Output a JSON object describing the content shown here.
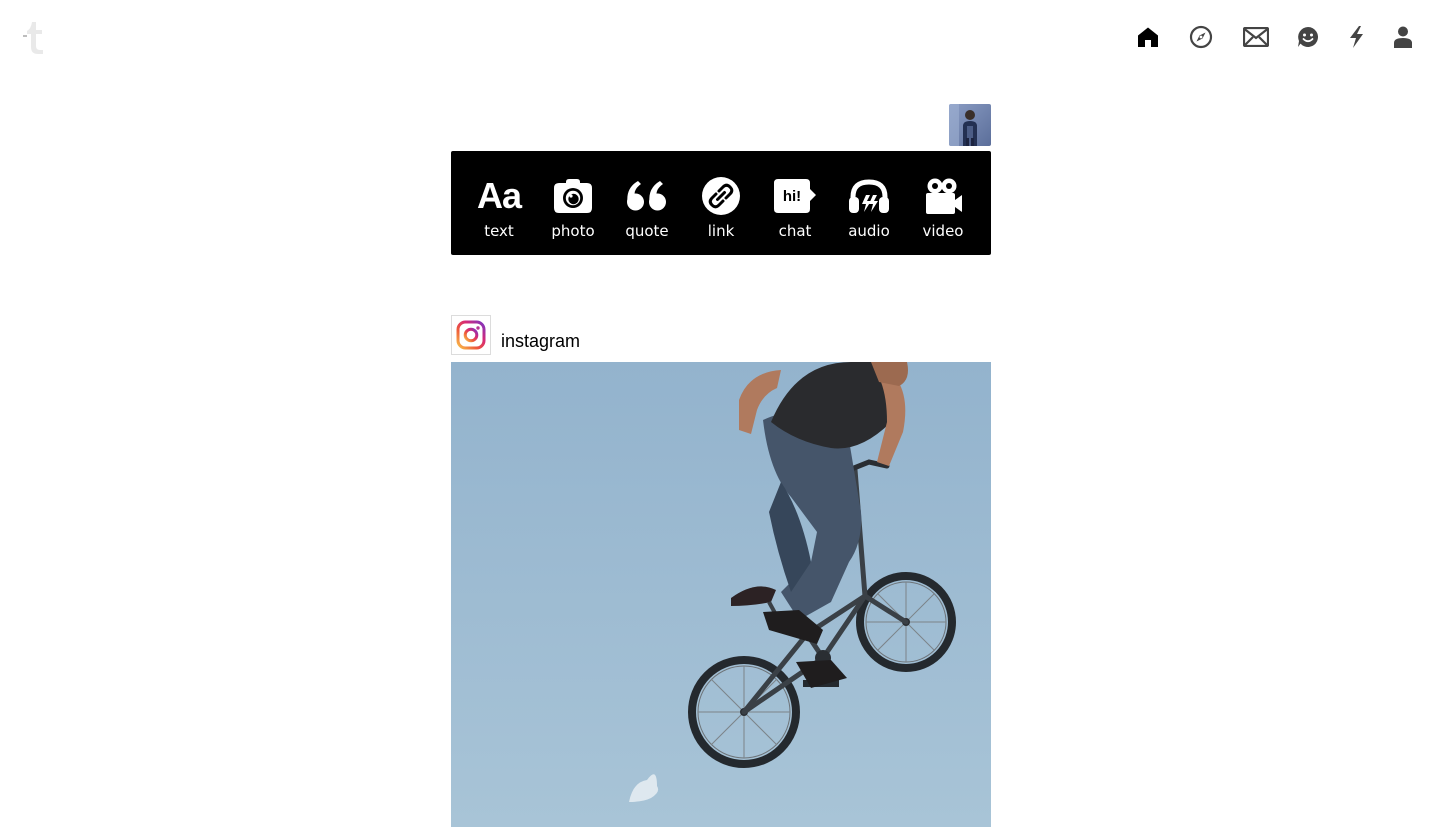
{
  "header": {
    "logo_icon": "tumblr-logo",
    "nav": [
      {
        "id": "home",
        "icon": "home-icon"
      },
      {
        "id": "explore",
        "icon": "compass-icon"
      },
      {
        "id": "inbox",
        "icon": "envelope-icon"
      },
      {
        "id": "messaging",
        "icon": "smiley-chat-icon"
      },
      {
        "id": "activity",
        "icon": "lightning-icon"
      },
      {
        "id": "account",
        "icon": "person-icon"
      }
    ],
    "active_nav": "home"
  },
  "composer": {
    "avatar_icon": "user-avatar",
    "text_glyph": "Aa",
    "chat_glyph": "hi!",
    "post_types": [
      {
        "label": "text",
        "icon": "text-aa-icon"
      },
      {
        "label": "photo",
        "icon": "camera-icon"
      },
      {
        "label": "quote",
        "icon": "quote-marks-icon"
      },
      {
        "label": "link",
        "icon": "link-icon"
      },
      {
        "label": "chat",
        "icon": "chat-bubble-icon"
      },
      {
        "label": "audio",
        "icon": "headphones-icon"
      },
      {
        "label": "video",
        "icon": "video-camera-icon"
      }
    ]
  },
  "post": {
    "blog_name": "instagram",
    "avatar_icon": "instagram-logo",
    "photo_subject": "bmx-rider-photo"
  },
  "colors": {
    "composer_bg": "#000000",
    "composer_fg": "#ffffff",
    "sky": "#9fbdd2"
  }
}
